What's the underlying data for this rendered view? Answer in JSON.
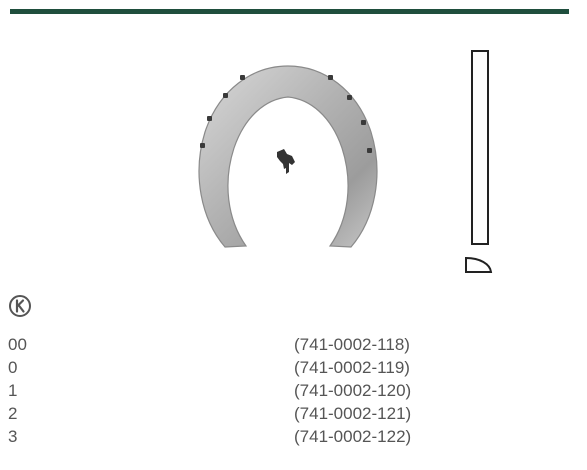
{
  "product": {
    "badge_letter": "K",
    "accent_color": "#1f4e3d",
    "logo_icon": "horse-silhouette-icon",
    "badge_icon": "k-circle-badge-icon"
  },
  "sizes": [
    {
      "size": "00",
      "code": "(741-0002-118)"
    },
    {
      "size": "0",
      "code": "(741-0002-119)"
    },
    {
      "size": "1",
      "code": "(741-0002-120)"
    },
    {
      "size": "2",
      "code": "(741-0002-121)"
    },
    {
      "size": "3",
      "code": "(741-0002-122)"
    }
  ]
}
